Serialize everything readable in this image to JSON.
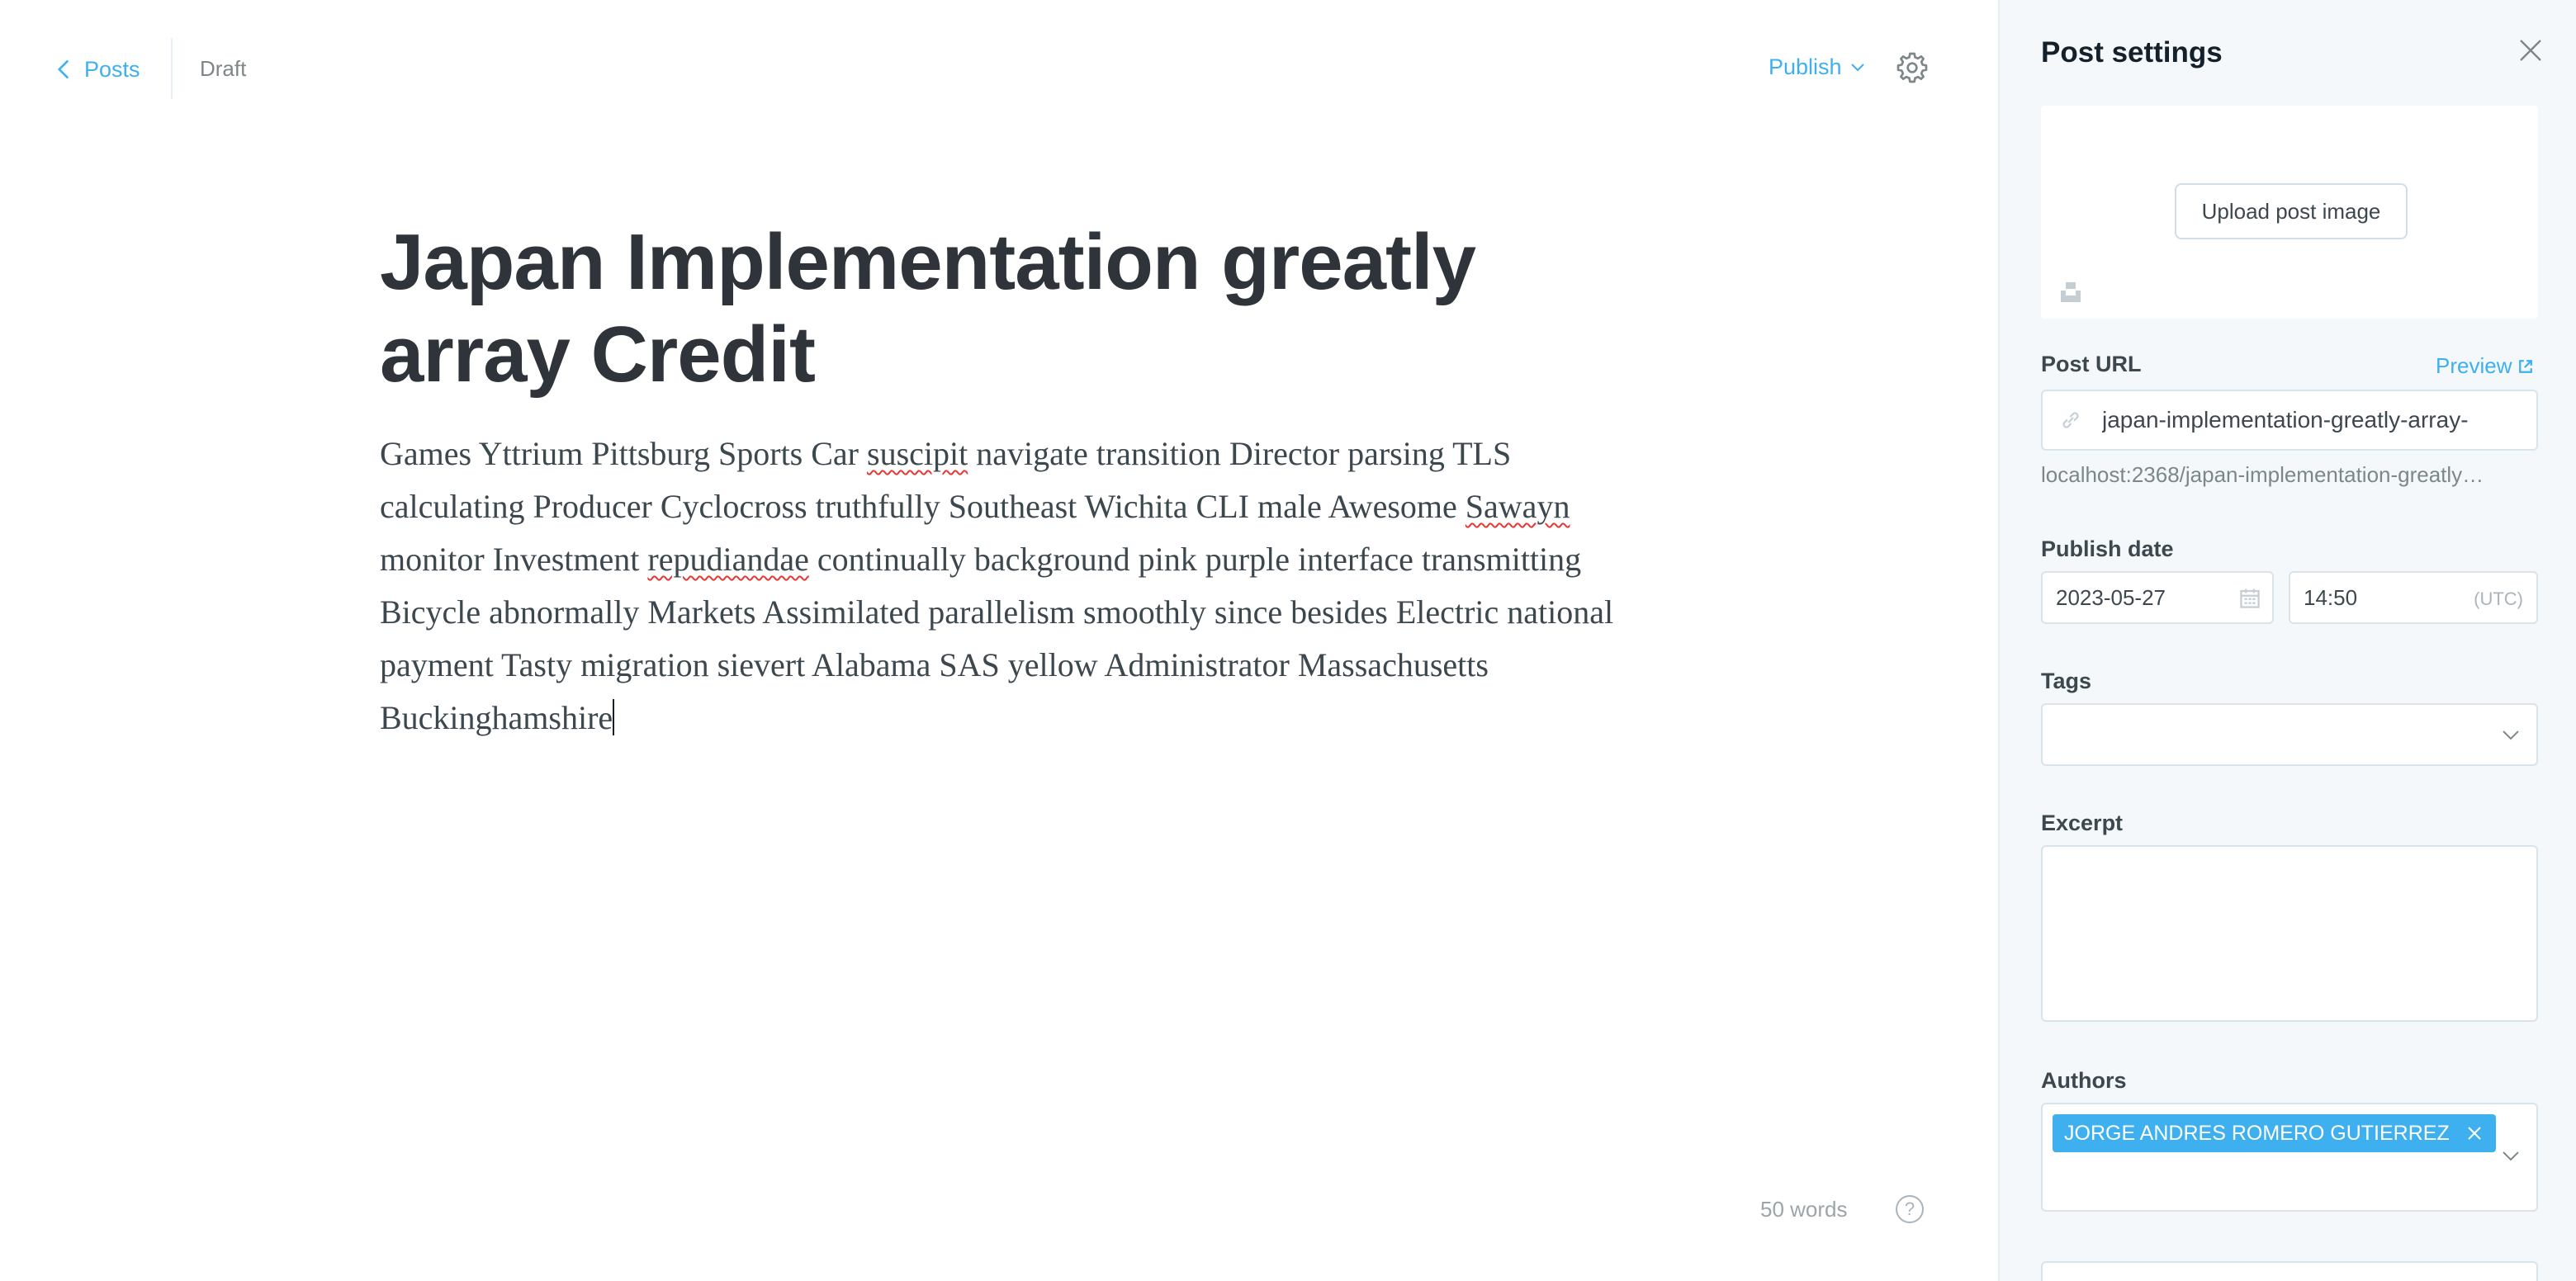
{
  "header": {
    "back_label": "Posts",
    "status": "Draft",
    "publish_label": "Publish"
  },
  "post": {
    "title": "Japan Implementation greatly array Credit",
    "body_segments": [
      {
        "text": "Games Yttrium Pittsburg Sports Car ",
        "misspelled": false
      },
      {
        "text": "suscipit",
        "misspelled": true
      },
      {
        "text": " navigate transition Director parsing TLS calculating Producer Cyclocross truthfully Southeast Wichita CLI male Awesome ",
        "misspelled": false
      },
      {
        "text": "Sawayn",
        "misspelled": true
      },
      {
        "text": " monitor Investment ",
        "misspelled": false
      },
      {
        "text": "repudiandae",
        "misspelled": true
      },
      {
        "text": " continually background pink purple interface transmitting Bicycle abnormally Markets Assimilated parallelism smoothly since besides Electric national payment Tasty migration sievert Alabama SAS yellow Administrator Massachusetts Buckinghamshire",
        "misspelled": false
      }
    ]
  },
  "footer": {
    "word_count": "50 words",
    "help_icon": "question-circle-icon",
    "help_glyph": "?"
  },
  "settings": {
    "title": "Post settings",
    "upload_label": "Upload post image",
    "url_label": "Post URL",
    "preview_label": "Preview",
    "url_value": "japan-implementation-greatly-array-",
    "url_hint": "localhost:2368/japan-implementation-greatly…",
    "publish_date_label": "Publish date",
    "date_value": "2023-05-27",
    "time_value": "14:50",
    "timezone": "(UTC)",
    "tags_label": "Tags",
    "excerpt_label": "Excerpt",
    "authors_label": "Authors",
    "author_name": "JORGE ANDRES ROMERO GUTIERREZ"
  },
  "colors": {
    "accent": "#3eb0ef",
    "panel_bg": "#f4f8fb",
    "title_text": "#2e3439",
    "misspelling": "#e53935"
  }
}
